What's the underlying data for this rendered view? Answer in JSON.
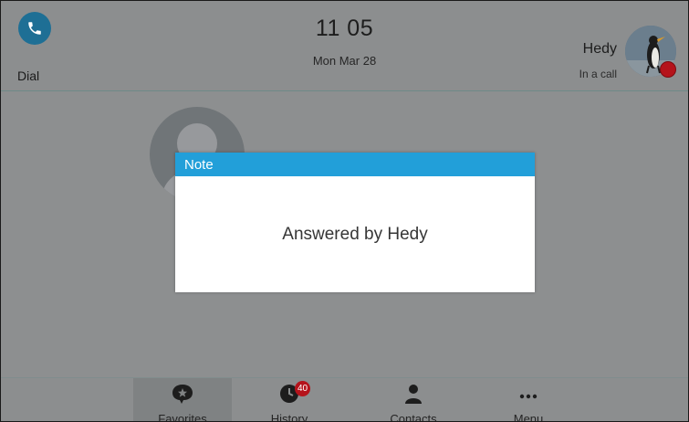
{
  "header": {
    "dial_label": "Dial",
    "time": "11 05",
    "date": "Mon Mar 28",
    "user_name": "Hedy",
    "user_status": "In a call",
    "status_color": "#b5131b"
  },
  "dialog": {
    "title": "Note",
    "message": "Answered by Hedy",
    "title_color": "#229fd9"
  },
  "softkeys": [
    {
      "label": "Favorites",
      "icon": "star-speech-bubble-icon",
      "active": true
    },
    {
      "label": "History",
      "icon": "history-clock-icon",
      "badge": "40"
    },
    {
      "label": "Contacts",
      "icon": "person-icon"
    },
    {
      "label": "Menu",
      "icon": "more-dots-icon"
    }
  ]
}
